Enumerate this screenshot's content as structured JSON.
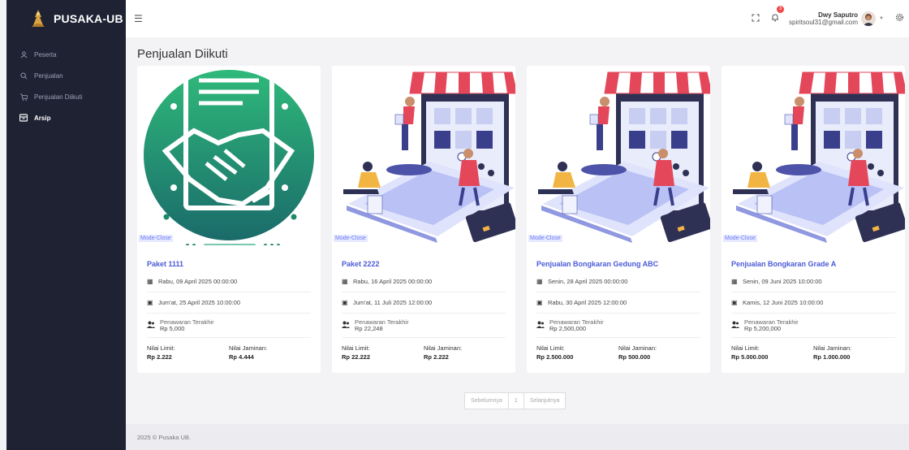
{
  "brand": {
    "name": "PUSAKA-UB"
  },
  "sidebar": {
    "items": [
      {
        "label": "Peserta",
        "icon": "user-icon",
        "active": false
      },
      {
        "label": "Penjualan",
        "icon": "search-icon",
        "active": false
      },
      {
        "label": "Penjualan Diikuti",
        "icon": "cart-icon",
        "active": false
      },
      {
        "label": "Arsip",
        "icon": "archive-icon",
        "active": true
      }
    ]
  },
  "topbar": {
    "notification_count": "3",
    "user_name": "Dwy Saputro",
    "user_email": "spiritsoul31@gmail.com"
  },
  "page": {
    "title": "Penjualan Diikuti"
  },
  "cards": [
    {
      "mode": "Mode-Close",
      "title": "Paket 1111",
      "start": "Rabu, 09 April 2025 00:00:00",
      "end": "Jum'at, 25 April 2025 10:00:00",
      "bid_label": "Penawaran Terakhir",
      "bid_value": "Rp 5,000",
      "limit_label": "Nilai Limit:",
      "limit_value": "Rp 2.222",
      "guarantee_label": "Nilai Jaminan:",
      "guarantee_value": "Rp 4.444",
      "image": "handshake"
    },
    {
      "mode": "Mode-Close",
      "title": "Paket 2222",
      "start": "Rabu, 16 April 2025 00:00:00",
      "end": "Jum'at, 11 Juli 2025 12:00:00",
      "bid_label": "Penawaran Terakhir",
      "bid_value": "Rp 22,248",
      "limit_label": "Nilai Limit:",
      "limit_value": "Rp 22.222",
      "guarantee_label": "Nilai Jaminan:",
      "guarantee_value": "Rp 2.222",
      "image": "shop"
    },
    {
      "mode": "Mode-Close",
      "title": "Penjualan Bongkaran Gedung ABC",
      "start": "Senin, 28 April 2025 00:00:00",
      "end": "Rabu, 30 April 2025 12:00:00",
      "bid_label": "Penawaran Terakhir",
      "bid_value": "Rp 2,500,000",
      "limit_label": "Nilai Limit:",
      "limit_value": "Rp 2.500.000",
      "guarantee_label": "Nilai Jaminan:",
      "guarantee_value": "Rp 500.000",
      "image": "shop"
    },
    {
      "mode": "Mode-Close",
      "title": "Penjualan Bongkaran Grade A",
      "start": "Senin, 09 Juni 2025 10:00:00",
      "end": "Kamis, 12 Juni 2025 10:00:00",
      "bid_label": "Penawaran Terakhir",
      "bid_value": "Rp 5,200,000",
      "limit_label": "Nilai Limit:",
      "limit_value": "Rp 5.000.000",
      "guarantee_label": "Nilai Jaminan:",
      "guarantee_value": "Rp 1.000.000",
      "image": "shop"
    }
  ],
  "pagination": {
    "prev": "Sebelumnya",
    "current": "1",
    "next": "Selanjutnya"
  },
  "footer": {
    "text": "2025 © Pusaka UB."
  },
  "colors": {
    "sidebar": "#1e2233",
    "accent": "#4a5bd8",
    "teal": "#1b8a6b",
    "awning": "#e4475a"
  }
}
